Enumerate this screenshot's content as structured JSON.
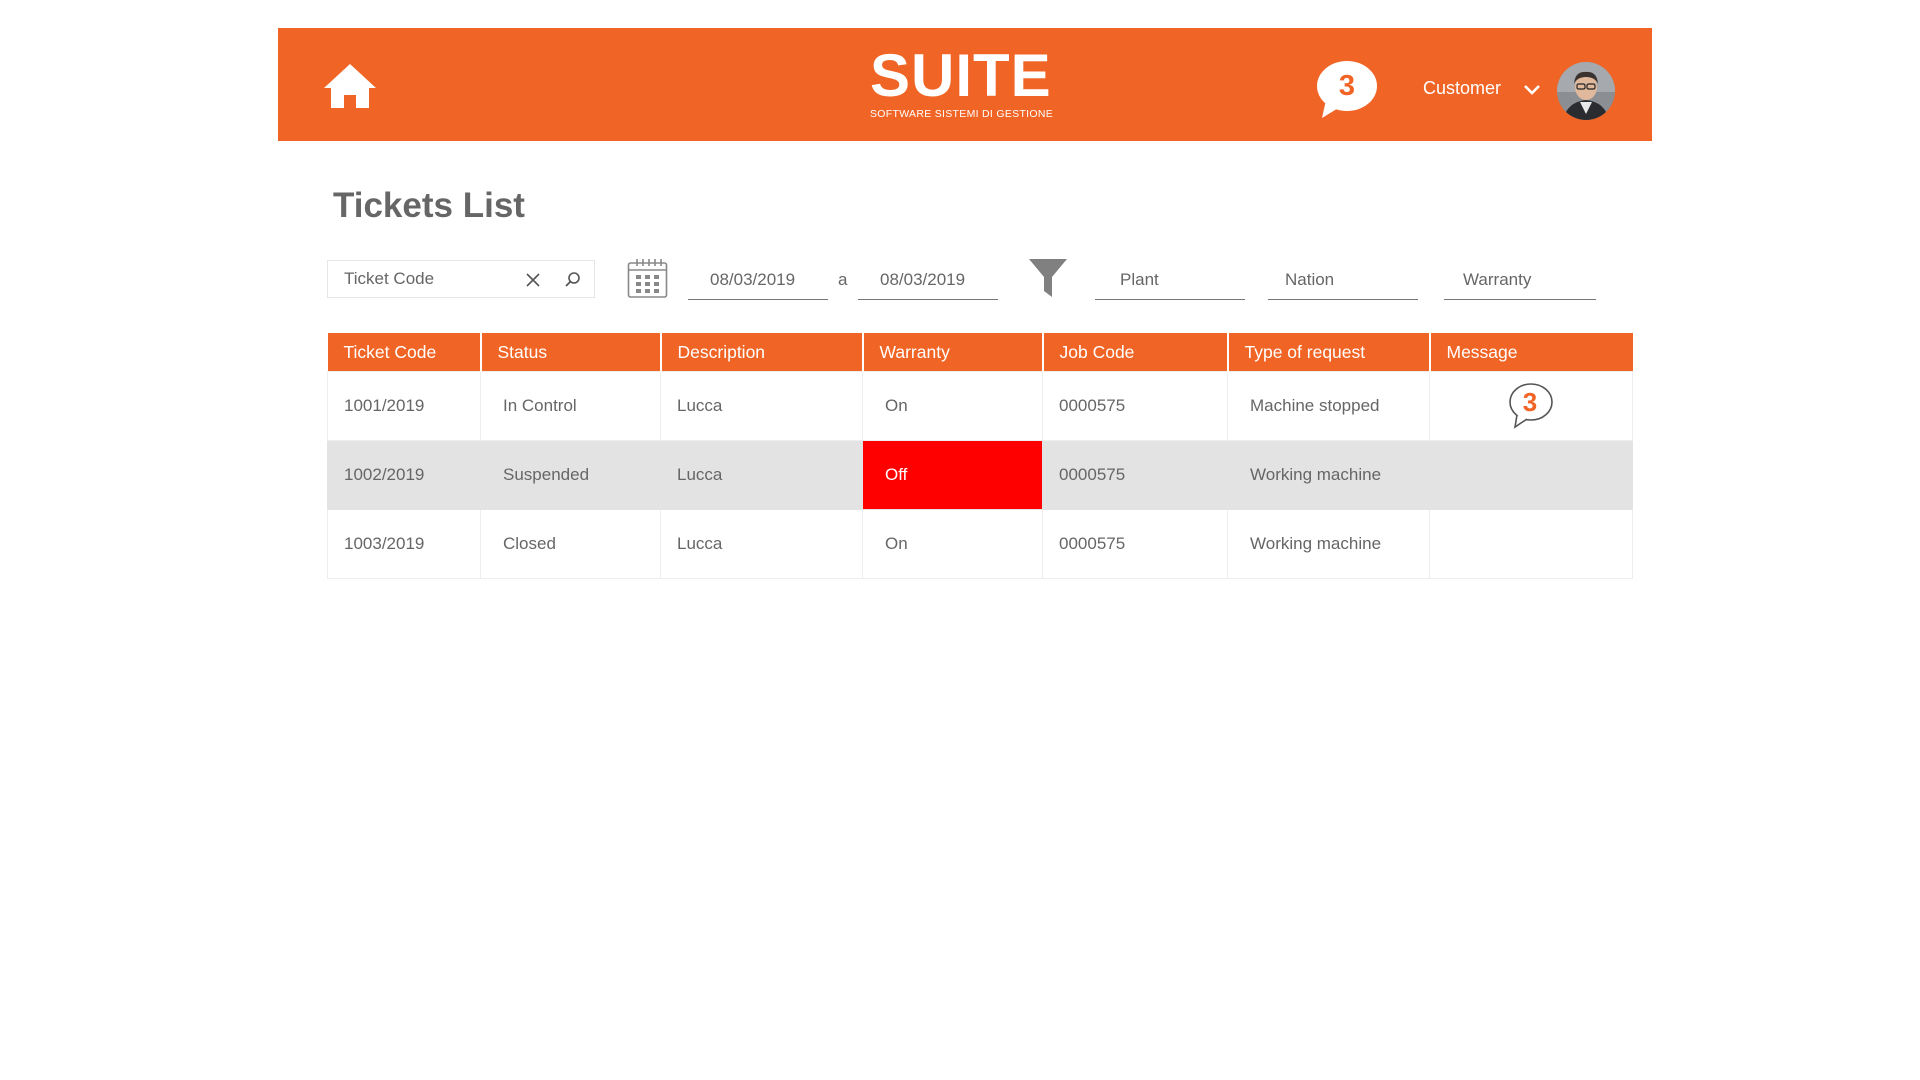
{
  "brand": {
    "accent": "#F06425",
    "alert": "#FF0000",
    "logo_text": "SUITE",
    "logo_subtitle": "SOFTWARE SISTEMI DI GESTIONE"
  },
  "header": {
    "home_icon": "home-icon",
    "notification_count": "3",
    "user_name": "Customer"
  },
  "page": {
    "title": "Tickets List"
  },
  "filters": {
    "search_placeholder": "Ticket Code",
    "date_from": "08/03/2019",
    "date_separator": "a",
    "date_to": "08/03/2019",
    "plant": "Plant",
    "nation": "Nation",
    "warranty": "Warranty"
  },
  "table": {
    "headers": [
      "Ticket Code",
      "Status",
      "Description",
      "Warranty",
      "Job Code",
      "Type of request",
      "Message"
    ],
    "rows": [
      {
        "ticket_code": "1001/2019",
        "status": "In Control",
        "description": "Lucca",
        "warranty": "On",
        "job_code": "0000575",
        "type": "Machine stopped",
        "message_count": "3"
      },
      {
        "ticket_code": "1002/2019",
        "status": "Suspended",
        "description": "Lucca",
        "warranty": "Off",
        "job_code": "0000575",
        "type": "Working machine",
        "message_count": ""
      },
      {
        "ticket_code": "1003/2019",
        "status": "Closed",
        "description": "Lucca",
        "warranty": "On",
        "job_code": "0000575",
        "type": "Working machine",
        "message_count": ""
      }
    ]
  }
}
